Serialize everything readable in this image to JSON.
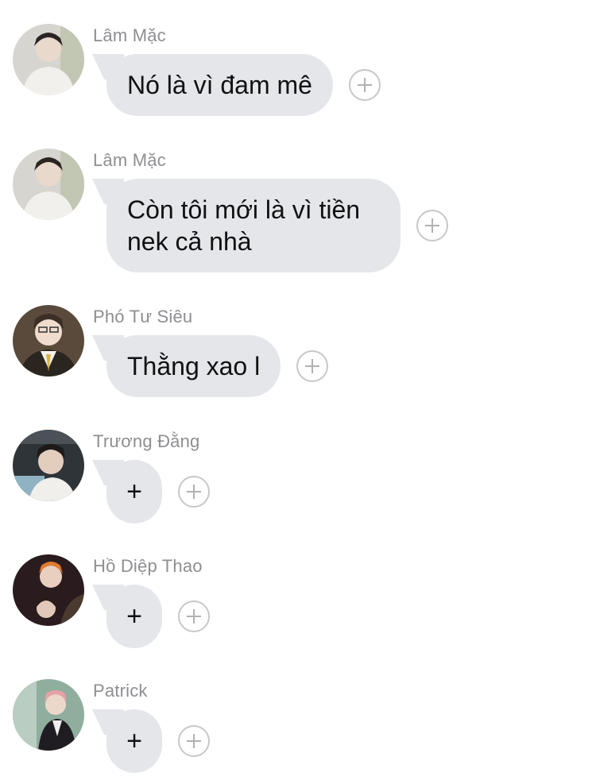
{
  "messages": [
    {
      "sender": "Lâm Mặc",
      "text": "Nó là vì đam mê",
      "avatar": "avatar-lam-mac"
    },
    {
      "sender": "Lâm Mặc",
      "text": "Còn tôi mới là vì tiền nek cả nhà",
      "avatar": "avatar-lam-mac"
    },
    {
      "sender": "Phó Tư Siêu",
      "text": "Thằng xao l",
      "avatar": "avatar-pho-tu-sieu"
    },
    {
      "sender": "Trương Đằng",
      "text": "+",
      "avatar": "avatar-truong-dang"
    },
    {
      "sender": "Hồ Diệp Thao",
      "text": "+",
      "avatar": "avatar-ho-diep-thao"
    },
    {
      "sender": "Patrick",
      "text": "+",
      "avatar": "avatar-patrick"
    }
  ],
  "icons": {
    "add_reaction": "plus-circle-icon"
  },
  "colors": {
    "bubble": "#e4e6ea",
    "sender_name": "#8e8e93",
    "add_icon_border": "#c7c7cc",
    "background": "#ffffff"
  }
}
